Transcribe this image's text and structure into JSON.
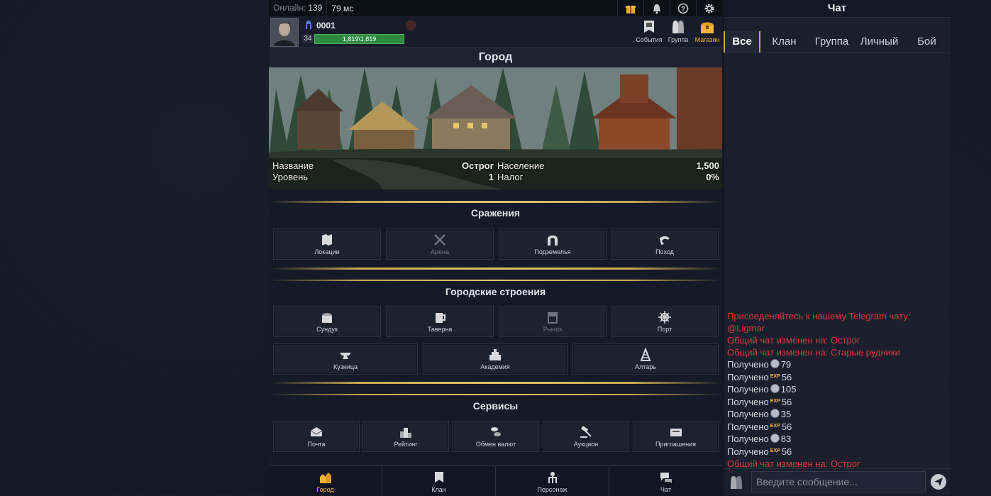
{
  "topbar": {
    "online_label": "Онлайн:",
    "online_count": "139",
    "ping": "79 мс"
  },
  "player": {
    "name": "0001",
    "level": "34",
    "hp": "1,819\\1,819",
    "hp_fraction": 1.0
  },
  "header_buttons": [
    {
      "label": "События"
    },
    {
      "label": "Группа"
    },
    {
      "label": "Магазин"
    }
  ],
  "city": {
    "title": "Город",
    "name_label": "Название",
    "name_value": "Острог",
    "level_label": "Уровень",
    "level_value": "1",
    "population_label": "Население",
    "population_value": "1,500",
    "tax_label": "Налог",
    "tax_value": "0%"
  },
  "battles": {
    "title": "Сражения",
    "items": [
      "Локации",
      "Арена",
      "Подземелья",
      "Поход"
    ]
  },
  "buildings": {
    "title": "Городские строения",
    "row1": [
      "Сундук",
      "Таверна",
      "Рынок",
      "Порт"
    ],
    "row2": [
      "Кузница",
      "Академия",
      "Алтарь"
    ]
  },
  "services": {
    "title": "Сервисы",
    "items": [
      "Почта",
      "Рейтинг",
      "Обмен валют",
      "Аукцион",
      "Приглашения"
    ]
  },
  "bottom_nav": [
    "Город",
    "Клан",
    "Персонаж",
    "Чат"
  ],
  "chat": {
    "title": "Чат",
    "tabs": [
      "Все",
      "Клан",
      "Группа",
      "Личный",
      "Бой"
    ],
    "messages": [
      {
        "type": "system",
        "text": "Присоеденяйтесь к нашему Telegram чату: @Ligmar"
      },
      {
        "type": "system",
        "text": "Общий чат изменен на: Острог"
      },
      {
        "type": "system",
        "text": "Общий чат изменен на: Старые рудники"
      },
      {
        "type": "reward",
        "label": "Получено",
        "icon": "coin-icon",
        "value": "79"
      },
      {
        "type": "reward",
        "label": "Получено",
        "icon": "exp-icon",
        "value": "56"
      },
      {
        "type": "reward",
        "label": "Получено",
        "icon": "coin-icon",
        "value": "105"
      },
      {
        "type": "reward",
        "label": "Получено",
        "icon": "exp-icon",
        "value": "56"
      },
      {
        "type": "reward",
        "label": "Получено",
        "icon": "coin-icon",
        "value": "35"
      },
      {
        "type": "reward",
        "label": "Получено",
        "icon": "exp-icon",
        "value": "56"
      },
      {
        "type": "reward",
        "label": "Получено",
        "icon": "coin-icon",
        "value": "83"
      },
      {
        "type": "reward",
        "label": "Получено",
        "icon": "exp-icon",
        "value": "56"
      },
      {
        "type": "system",
        "text": "Общий чат изменен на: Острог"
      }
    ],
    "exp_label": "EXP",
    "input_placeholder": "Введите сообщение..."
  },
  "colors": {
    "accent": "#f2b43a",
    "system_text": "#d33a3a",
    "hp": "#2b8a3e",
    "divider": "#c9a94f"
  }
}
